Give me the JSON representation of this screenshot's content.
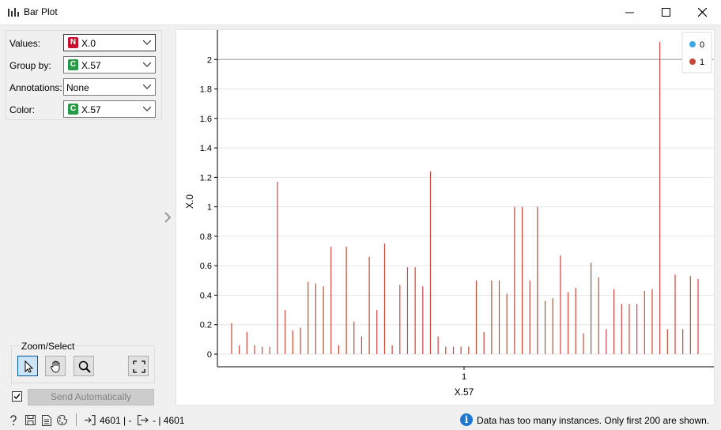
{
  "window": {
    "title": "Bar Plot"
  },
  "controls": {
    "values": {
      "label": "Values:",
      "badge": "N",
      "badge_color": "#c8102e",
      "value": "X.0"
    },
    "group_by": {
      "label": "Group by:",
      "badge": "C",
      "badge_color": "#2a9a46",
      "value": "X.57"
    },
    "annotations": {
      "label": "Annotations:",
      "value": "None"
    },
    "color": {
      "label": "Color:",
      "badge": "C",
      "badge_color": "#2a9a46",
      "value": "X.57"
    }
  },
  "zoom_select": {
    "title": "Zoom/Select",
    "tools": [
      "pointer-icon",
      "pan-hand-icon",
      "zoom-icon",
      "fit-view-icon"
    ],
    "selected": "pointer-icon"
  },
  "send": {
    "checked": true,
    "label": "Send Automatically"
  },
  "status": {
    "input_count": "4601 | -",
    "output_count": "- | 4601",
    "info": "Data has too many instances. Only first 200 are shown.",
    "icons": [
      "help-icon",
      "save-icon",
      "report-icon",
      "visual-settings-icon"
    ]
  },
  "chart_data": {
    "type": "bar",
    "xlabel": "X.57",
    "ylabel": "X.0",
    "x_ticks": [
      "1"
    ],
    "ylim": [
      0,
      2.2
    ],
    "y_ticks": [
      "0",
      "0.2",
      "0.4",
      "0.6",
      "0.8",
      "1",
      "1.2",
      "1.4",
      "1.6",
      "1.8",
      "2"
    ],
    "grid": true,
    "legend": {
      "placement": "top-right",
      "items": [
        {
          "name": "0",
          "color": "#3fa9e6"
        },
        {
          "name": "1",
          "color": "#c8473a"
        }
      ]
    },
    "series": [
      {
        "name": "0",
        "color": "#3fa9e6",
        "values": []
      },
      {
        "name": "1",
        "color": "#c8473a",
        "values": [
          0.21,
          0.06,
          0.15,
          0.06,
          0.05,
          0.05,
          1.17,
          0.3,
          0.16,
          0.18,
          0.49,
          0.48,
          0.46,
          0.73,
          0.06,
          0.73,
          0.22,
          0.12,
          0.66,
          0.3,
          0.75,
          0.06,
          0.47,
          0.59,
          0.59,
          0.46,
          1.24,
          0.12,
          0.05,
          0.05,
          0.05,
          0.05,
          0.5,
          0.15,
          0.5,
          0.5,
          0.41,
          1.0,
          1.0,
          0.5,
          1.0,
          0.36,
          0.38,
          0.67,
          0.42,
          0.45,
          0.14,
          0.62,
          0.52,
          0.17,
          0.44,
          0.34,
          0.34,
          0.34,
          0.43,
          0.44,
          2.12,
          0.17,
          0.54,
          0.17,
          0.53,
          0.51
        ]
      }
    ]
  }
}
